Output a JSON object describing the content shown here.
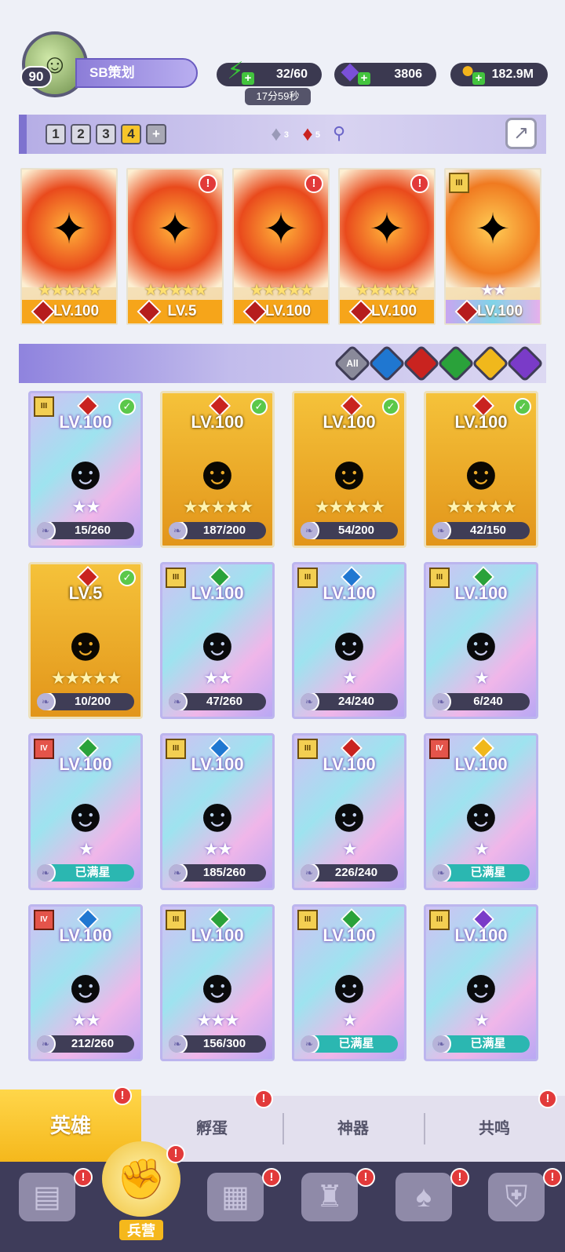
{
  "player": {
    "level": "90",
    "name": "SB策划",
    "avatar_icon": "avatar-icon"
  },
  "resources": {
    "stamina": "32/60",
    "stamina_timer": "17分59秒",
    "gems": "3806",
    "gold": "182.9M"
  },
  "team_bar": {
    "tabs": [
      "1",
      "2",
      "3",
      "4"
    ],
    "active_tab": "4",
    "add_label": "+",
    "crystal_white_count": "3",
    "crystal_red_count": "5"
  },
  "team_slots": [
    {
      "level": "LV.100",
      "stars": "★★★★★",
      "alert": "",
      "rank": ""
    },
    {
      "level": "LV.5",
      "stars": "★★★★★",
      "alert": "!",
      "rank": ""
    },
    {
      "level": "LV.100",
      "stars": "★★★★★",
      "alert": "!",
      "rank": ""
    },
    {
      "level": "LV.100",
      "stars": "★★★★★",
      "alert": "!",
      "rank": ""
    },
    {
      "level": "LV.100",
      "stars": "★★",
      "alert": "",
      "rank": "III"
    }
  ],
  "filters": {
    "all_label": "All"
  },
  "heroes": [
    {
      "level": "LV.100",
      "stars": "★★",
      "progress": "15/260",
      "rank": "III",
      "style": "rainbow",
      "element": "fire",
      "check": true
    },
    {
      "level": "LV.100",
      "stars": "★★★★★",
      "progress": "187/200",
      "rank": "",
      "style": "gold",
      "element": "fire",
      "check": true
    },
    {
      "level": "LV.100",
      "stars": "★★★★★",
      "progress": "54/200",
      "rank": "",
      "style": "gold",
      "element": "fire",
      "check": true
    },
    {
      "level": "LV.100",
      "stars": "★★★★★",
      "progress": "42/150",
      "rank": "",
      "style": "gold",
      "element": "fire",
      "check": true
    },
    {
      "level": "LV.5",
      "stars": "★★★★★",
      "progress": "10/200",
      "rank": "",
      "style": "gold",
      "element": "fire",
      "check": true
    },
    {
      "level": "LV.100",
      "stars": "★★",
      "progress": "47/260",
      "rank": "III",
      "style": "rainbow",
      "element": "earth",
      "check": false
    },
    {
      "level": "LV.100",
      "stars": "★",
      "progress": "24/240",
      "rank": "III",
      "style": "rainbow",
      "element": "water",
      "check": false
    },
    {
      "level": "LV.100",
      "stars": "★",
      "progress": "6/240",
      "rank": "III",
      "style": "rainbow",
      "element": "earth",
      "check": false
    },
    {
      "level": "LV.100",
      "stars": "★",
      "progress": "已满星",
      "rank": "IV",
      "style": "rainbow",
      "element": "earth",
      "check": false
    },
    {
      "level": "LV.100",
      "stars": "★★",
      "progress": "185/260",
      "rank": "III",
      "style": "rainbow",
      "element": "water",
      "check": false
    },
    {
      "level": "LV.100",
      "stars": "★",
      "progress": "226/240",
      "rank": "III",
      "style": "rainbow",
      "element": "fire",
      "check": false
    },
    {
      "level": "LV.100",
      "stars": "★",
      "progress": "已满星",
      "rank": "IV",
      "style": "rainbow",
      "element": "light",
      "check": false
    },
    {
      "level": "LV.100",
      "stars": "★★",
      "progress": "212/260",
      "rank": "IV",
      "style": "rainbow",
      "element": "water",
      "check": false
    },
    {
      "level": "LV.100",
      "stars": "★★★",
      "progress": "156/300",
      "rank": "III",
      "style": "rainbow",
      "element": "earth",
      "check": false
    },
    {
      "level": "LV.100",
      "stars": "★",
      "progress": "已满星",
      "rank": "III",
      "style": "rainbow",
      "element": "earth",
      "check": false
    },
    {
      "level": "LV.100",
      "stars": "★",
      "progress": "已满星",
      "rank": "III",
      "style": "rainbow",
      "element": "dark",
      "check": false
    }
  ],
  "subtabs": [
    "英雄",
    "孵蛋",
    "神器",
    "共鸣"
  ],
  "navbar": {
    "active_label": "兵营"
  },
  "colors": {
    "fire": "#c9231f",
    "water": "#1f77d1",
    "earth": "#2aa23a",
    "light": "#f0b81c",
    "dark": "#7a3bc8",
    "accent": "#f5b81c"
  }
}
